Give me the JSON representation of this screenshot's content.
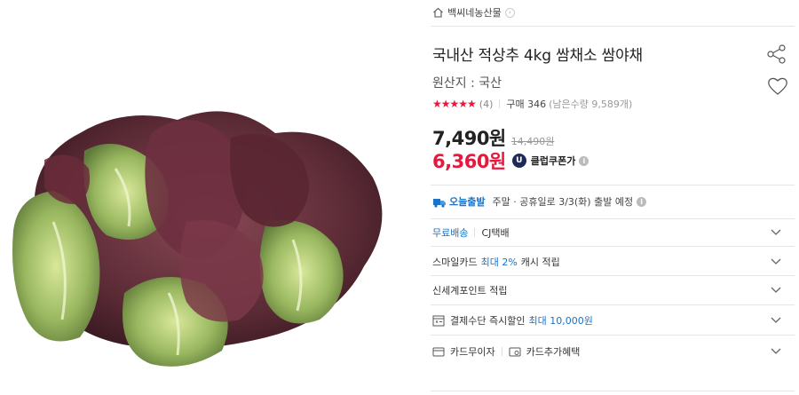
{
  "breadcrumb": {
    "store_name": "백씨네농산물"
  },
  "product": {
    "title": "국내산 적상추 4kg 쌈채소 쌈야채",
    "origin": "원산지 : 국산",
    "rating_stars": "★★★★★",
    "rating_value": 5,
    "review_count": "(4)",
    "purchase_count": "구매 346",
    "remaining_stock": "(남은수량 9,589개)",
    "price": "7,490원",
    "original_price": "14,490원",
    "sale_price": "6,360원",
    "club_badge": "U",
    "club_coupon_label": "클럽쿠폰가"
  },
  "delivery": {
    "today_label": "오늘출발",
    "schedule_text": "주말 · 공휴일로 3/3(화) 출발 예정"
  },
  "options": {
    "free_shipping_label": "무료배송",
    "courier": "CJ택배",
    "smile_card_prefix": "스마일카드",
    "smile_card_highlight": "최대 2%",
    "smile_card_suffix": "캐시 적립",
    "shinsegae_points": "신세계포인트 적립",
    "payment_discount_prefix": "결제수단 즉시할인",
    "payment_discount_highlight": "최대 10,000원",
    "card_installment": "카드무이자",
    "card_benefit": "카드추가혜택"
  },
  "colors": {
    "accent_red": "#e8173d",
    "link_blue": "#1a73c8",
    "club_navy": "#1f2a5c"
  },
  "icons": [
    "home-icon",
    "share-icon",
    "heart-icon",
    "truck-icon",
    "info-icon",
    "chevron-down-icon",
    "calculator-icon",
    "card-icon",
    "card-gift-icon"
  ]
}
